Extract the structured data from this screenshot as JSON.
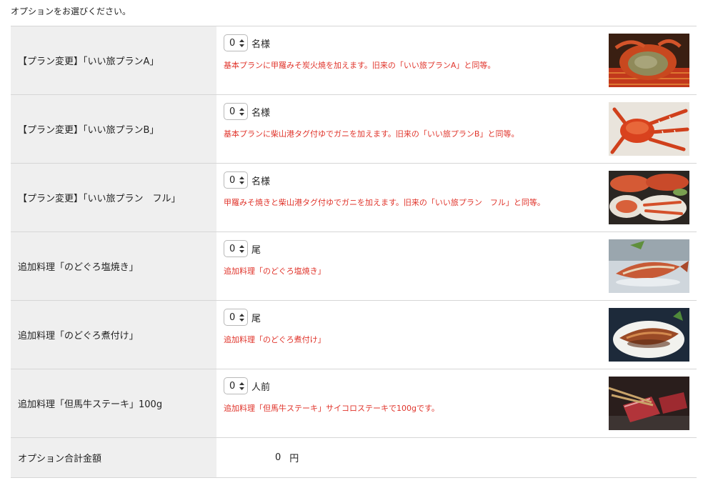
{
  "intro": "オプションをお選びください。",
  "options": [
    {
      "label": "【プラン変更】「いい旅プランA」",
      "qty": "0",
      "unit": "名様",
      "description": "基本プランに甲羅みそ炭火焼を加えます。旧来の「いい旅プランA」と同等。",
      "image": "grilled-crab-shell-image"
    },
    {
      "label": "【プラン変更】「いい旅プランB」",
      "qty": "0",
      "unit": "名様",
      "description": "基本プランに柴山港タグ付ゆでガニを加えます。旧来の「いい旅プランB」と同等。",
      "image": "boiled-crab-image"
    },
    {
      "label": "【プラン変更】「いい旅プラン　フル」",
      "qty": "0",
      "unit": "名様",
      "description": "甲羅みそ焼きと柴山港タグ付ゆでガニを加えます。旧来の「いい旅プラン　フル」と同等。",
      "image": "crab-feast-image"
    },
    {
      "label": "追加料理「のどぐろ塩焼き」",
      "qty": "0",
      "unit": "尾",
      "description": "追加料理「のどぐろ塩焼き」",
      "image": "salt-grilled-fish-image"
    },
    {
      "label": "追加料理「のどぐろ煮付け」",
      "qty": "0",
      "unit": "尾",
      "description": "追加料理「のどぐろ煮付け」",
      "image": "simmered-fish-image"
    },
    {
      "label": "追加料理「但馬牛ステーキ」100g",
      "qty": "0",
      "unit": "人前",
      "description": "追加料理「但馬牛ステーキ」サイコロステーキで100gです。",
      "image": "beef-steak-image"
    }
  ],
  "total": {
    "label": "オプション合計金額",
    "amount": "0",
    "currency": "円"
  },
  "colors": {
    "label_bg": "#efefef",
    "description_text": "#e0342b",
    "border": "#d6d6d6"
  }
}
